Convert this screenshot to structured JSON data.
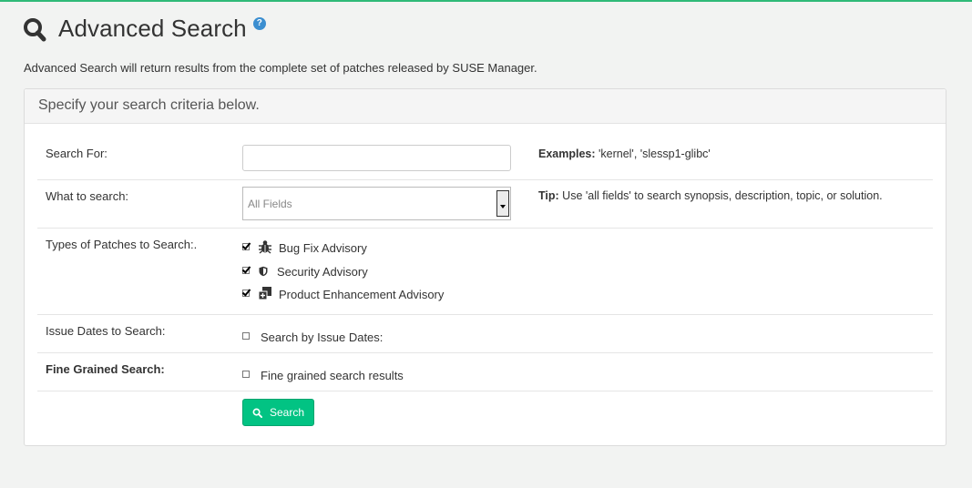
{
  "header": {
    "title": "Advanced Search",
    "help_label": "?",
    "description": "Advanced Search will return results from the complete set of patches released by SUSE Manager."
  },
  "panel": {
    "heading": "Specify your search criteria below."
  },
  "form": {
    "search_for": {
      "label": "Search For:",
      "value": "",
      "examples_label": "Examples:",
      "examples_text": " 'kernel', 'slessp1-glibc'"
    },
    "what_to_search": {
      "label": "What to search:",
      "selected": "All Fields",
      "tip_label": "Tip:",
      "tip_text": " Use 'all fields' to search synopsis, description, topic, or solution."
    },
    "patch_types": {
      "label": "Types of Patches to Search:.",
      "options": [
        {
          "label": "Bug Fix Advisory",
          "checked": true,
          "icon": "bug-icon"
        },
        {
          "label": "Security Advisory",
          "checked": true,
          "icon": "shield-icon"
        },
        {
          "label": "Product Enhancement Advisory",
          "checked": true,
          "icon": "enhancement-icon"
        }
      ]
    },
    "issue_dates": {
      "label": "Issue Dates to Search:",
      "option_label": "Search by Issue Dates:",
      "checked": false
    },
    "fine_grained": {
      "label": "Fine Grained Search:",
      "option_label": "Fine grained search results",
      "checked": false
    },
    "search_button": "Search"
  },
  "colors": {
    "accent": "#30ba78",
    "button": "#02c383",
    "help": "#3b8ed0"
  }
}
